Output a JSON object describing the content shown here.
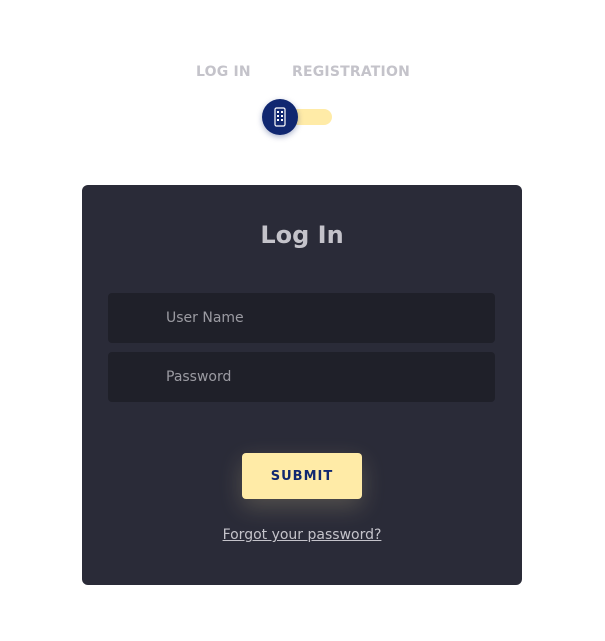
{
  "tabs": {
    "login_label": "LOG IN",
    "register_label": "REGISTRATION"
  },
  "toggle": {
    "icon": "toggle-switch-icon",
    "state": "login"
  },
  "card": {
    "title": "Log In",
    "username_placeholder": "User Name",
    "password_placeholder": "Password",
    "submit_label": "SUBMIT",
    "forgot_label": "Forgot your password?"
  },
  "colors": {
    "background": "#ffffff",
    "card": "#2a2b38",
    "field": "#1f2029",
    "accent": "#ffeba7",
    "knob": "#102770",
    "text": "#c4c3ca"
  }
}
